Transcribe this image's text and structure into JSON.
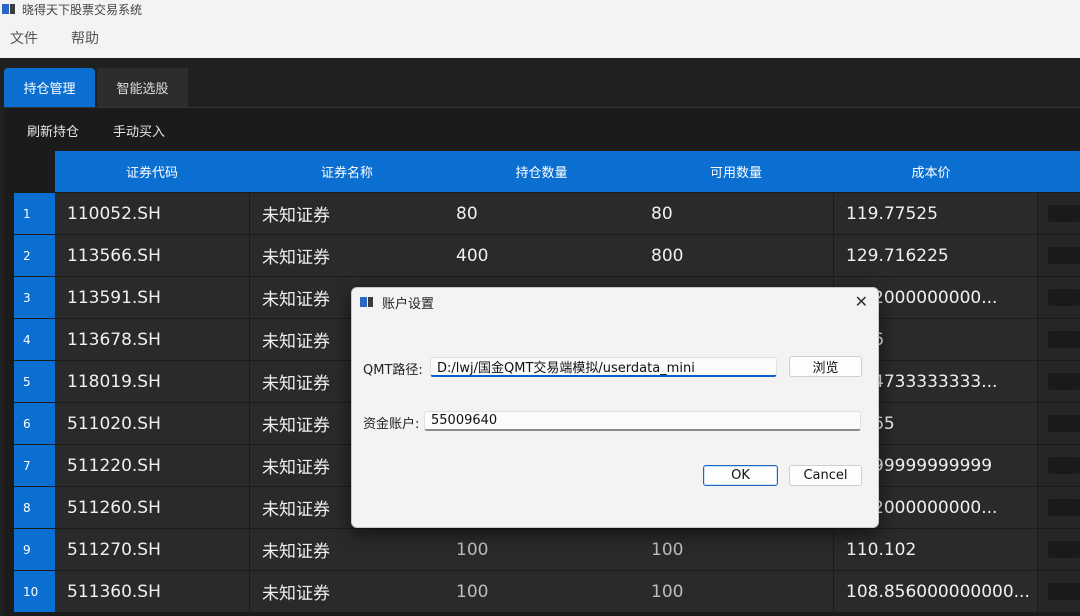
{
  "window": {
    "title": "晓得天下股票交易系统"
  },
  "menu": [
    "文件",
    "帮助"
  ],
  "tabs": [
    {
      "label": "持仓管理",
      "active": true
    },
    {
      "label": "智能选股",
      "active": false
    }
  ],
  "toolbar": {
    "refresh_label": "刷新持仓",
    "manual_buy_label": "手动买入"
  },
  "table": {
    "columns": [
      "证券代码",
      "证券名称",
      "持仓数量",
      "可用数量",
      "成本价"
    ],
    "rows": [
      {
        "num": "1",
        "code": "110052.SH",
        "name": "未知证券",
        "qty": "80",
        "avail": "80",
        "cost": "119.77525"
      },
      {
        "num": "2",
        "code": "113566.SH",
        "name": "未知证券",
        "qty": "400",
        "avail": "800",
        "cost": "129.716225"
      },
      {
        "num": "3",
        "code": "113591.SH",
        "name": "未知证券",
        "qty": "",
        "avail": "",
        "cost": ".992000000000..."
      },
      {
        "num": "4",
        "code": "113678.SH",
        "name": "未知证券",
        "qty": "",
        "avail": "",
        "cost": ".796"
      },
      {
        "num": "5",
        "code": "118019.SH",
        "name": "未知证券",
        "qty": "",
        "avail": "",
        "cost": ".464733333333..."
      },
      {
        "num": "6",
        "code": "511020.SH",
        "name": "未知证券",
        "qty": "",
        "avail": "",
        "cost": ".6065"
      },
      {
        "num": "7",
        "code": "511220.SH",
        "name": "未知证券",
        "qty": "",
        "avail": "",
        "cost": ".4399999999999"
      },
      {
        "num": "8",
        "code": "511260.SH",
        "name": "未知证券",
        "qty": "",
        "avail": "",
        "cost": ".062000000000..."
      },
      {
        "num": "9",
        "code": "511270.SH",
        "name": "未知证券",
        "qty": "100",
        "avail": "100",
        "cost": "110.102"
      },
      {
        "num": "10",
        "code": "511360.SH",
        "name": "未知证券",
        "qty": "100",
        "avail": "100",
        "cost": "108.856000000000..."
      }
    ]
  },
  "dialog": {
    "title": "账户设置",
    "close_glyph": "✕",
    "qmt_label": "QMT路径:",
    "qmt_value": "D:/lwj/国金QMT交易端模拟/userdata_mini",
    "browse_label": "浏览",
    "account_label": "资金账户:",
    "account_value": "55009640",
    "ok_label": "OK",
    "cancel_label": "Cancel"
  },
  "colors": {
    "accent": "#0a6fd1",
    "cell_bg": "#2a2a2a",
    "dialog_bg": "#f3f3f3"
  }
}
